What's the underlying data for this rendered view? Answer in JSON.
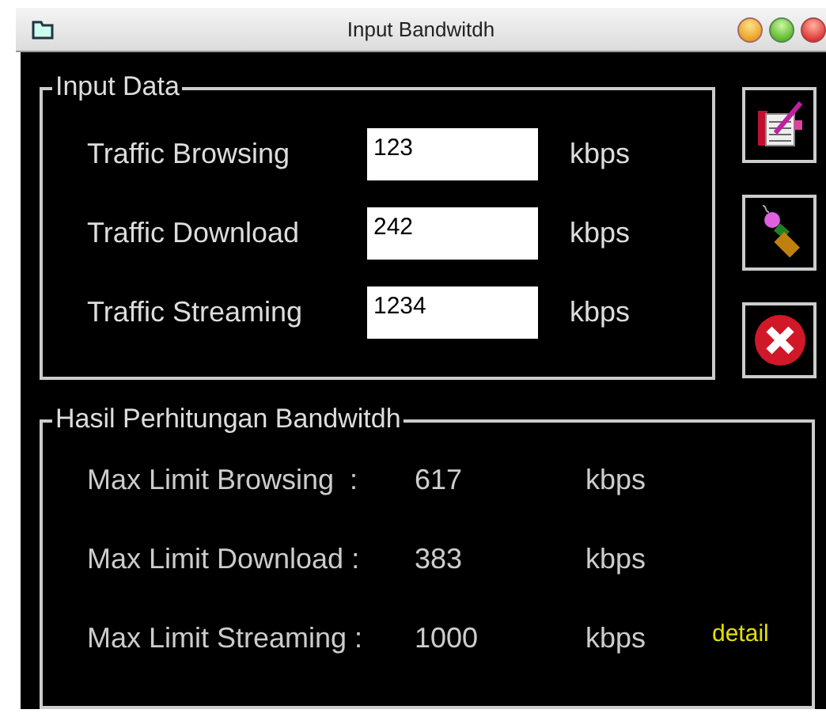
{
  "window": {
    "title": "Input Bandwitdh"
  },
  "input_data": {
    "title": "Input Data",
    "rows": [
      {
        "label": "Traffic Browsing",
        "value": "123",
        "unit": "kbps"
      },
      {
        "label": "Traffic Download",
        "value": "242",
        "unit": "kbps"
      },
      {
        "label": "Traffic Streaming",
        "value": "1234",
        "unit": "kbps"
      }
    ]
  },
  "buttons": [
    {
      "kind": "edit"
    },
    {
      "kind": "clear"
    },
    {
      "kind": "close"
    }
  ],
  "results": {
    "title": "Hasil Perhitungan Bandwitdh",
    "rows": [
      {
        "label": "Max Limit Browsing  :",
        "value": "617",
        "unit": "kbps"
      },
      {
        "label": "Max Limit Download :",
        "value": "383",
        "unit": "kbps"
      },
      {
        "label": "Max Limit Streaming :",
        "value": "1000",
        "unit": "kbps",
        "link": "detail"
      }
    ]
  }
}
